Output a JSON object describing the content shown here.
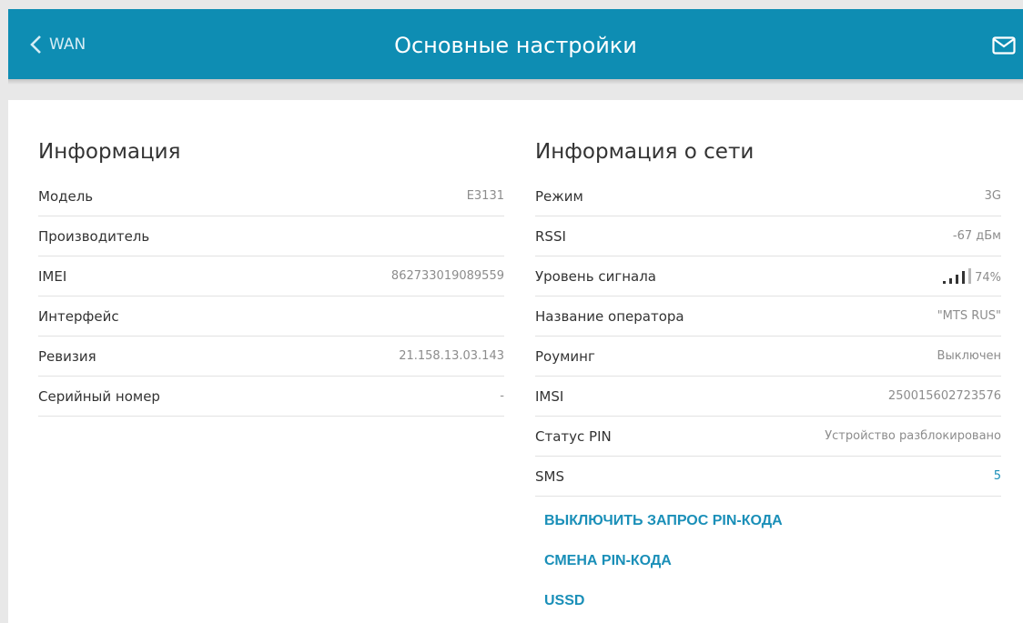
{
  "header": {
    "back_label": "WAN",
    "title": "Основные настройки",
    "mail_icon": "envelope-icon",
    "color": "#0e8db3"
  },
  "info": {
    "title": "Информация",
    "rows": [
      {
        "label": "Модель",
        "value": "E3131"
      },
      {
        "label": "Производитель",
        "value": ""
      },
      {
        "label": "IMEI",
        "value": "862733019089559"
      },
      {
        "label": "Интерфейс",
        "value": ""
      },
      {
        "label": "Ревизия",
        "value": "21.158.13.03.143"
      },
      {
        "label": "Серийный номер",
        "value": "-"
      }
    ]
  },
  "network": {
    "title": "Информация о сети",
    "rows": [
      {
        "label": "Режим",
        "value": "3G"
      },
      {
        "label": "RSSI",
        "value": "-67 дБм"
      },
      {
        "label": "Уровень сигнала",
        "value": "74%",
        "signal_level": 0.74
      },
      {
        "label": "Название оператора",
        "value": "\"MTS RUS\""
      },
      {
        "label": "Роуминг",
        "value": "Выключен"
      },
      {
        "label": "IMSI",
        "value": "250015602723576"
      },
      {
        "label": "Статус PIN",
        "value": "Устройство разблокировано"
      },
      {
        "label": "SMS",
        "value": "5"
      }
    ],
    "actions": [
      {
        "label": "ВЫКЛЮЧИТЬ ЗАПРОС PIN-КОДА"
      },
      {
        "label": "СМЕНА PIN-КОДА"
      },
      {
        "label": "USSD"
      }
    ]
  }
}
